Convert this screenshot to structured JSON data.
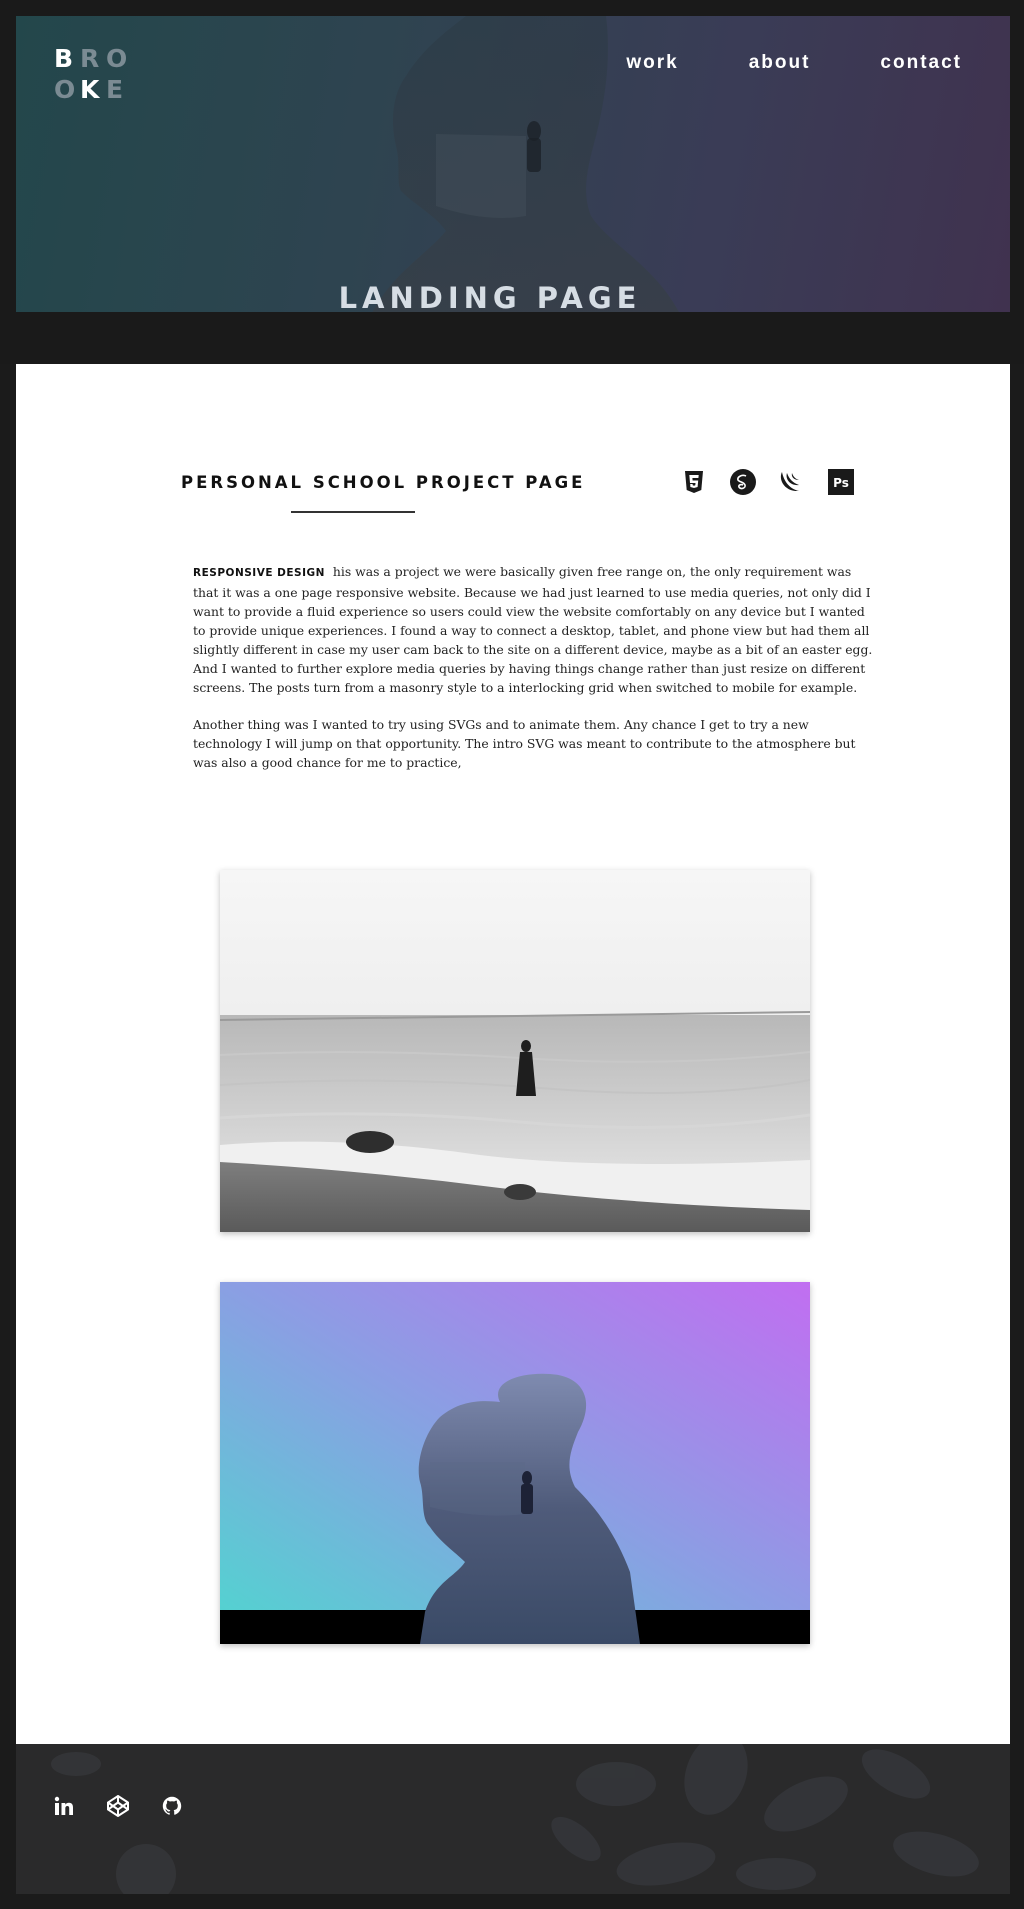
{
  "logo": {
    "letters": [
      "B",
      "R",
      "O",
      "O",
      "K",
      "E"
    ]
  },
  "nav": {
    "items": [
      {
        "label": "work"
      },
      {
        "label": "about"
      },
      {
        "label": "contact"
      }
    ]
  },
  "hero": {
    "title": "LANDING PAGE"
  },
  "project": {
    "title": "PERSONAL SCHOOL PROJECT PAGE",
    "tech_icons": [
      "html5-icon",
      "sass-icon",
      "jquery-icon",
      "photoshop-icon"
    ],
    "photoshop_label": "Ps",
    "lead": "RESPONSIVE DESIGN",
    "paragraph_1": "his was a project we were basically given free range on, the only requirement was that it was a one page responsive website. Because we had just learned to use media queries, not only did I want to provide a fluid experience so users could view the website comfortably on any device but I wanted to provide unique experiences. I found a way to connect a desktop, tablet, and phone view but had them all slightly different in case my user cam back to the site on a different device, maybe as a bit of an easter egg. And I wanted to further explore media queries by having things change rather than just resize on different screens. The posts turn from a masonry style to a interlocking grid when switched to mobile for example.",
    "paragraph_2": "Another thing was I wanted to try using SVGs and to animate them. Any chance I get to try a new technology I will jump on that opportunity. The intro SVG was meant to contribute to the atmosphere but was also a good chance for me to practice,"
  },
  "footer": {
    "social": [
      "linkedin-icon",
      "codepen-icon",
      "github-icon"
    ]
  },
  "colors": {
    "hero_gradient_start": "#23474b",
    "hero_gradient_end": "#40324f",
    "photo2_gradient_start": "#4fd6cf",
    "photo2_gradient_end": "#c16ef1",
    "footer_bg": "#2a2a2b"
  }
}
